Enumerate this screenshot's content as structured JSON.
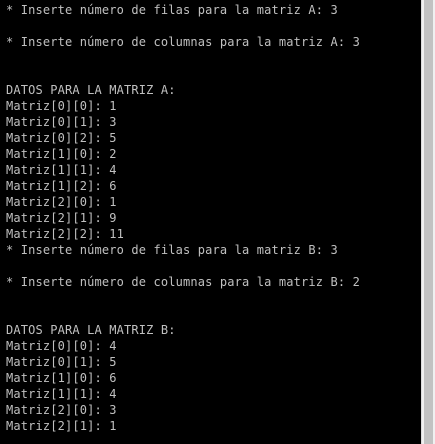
{
  "console": {
    "background": "#000000",
    "text_color": "#c0c0c0",
    "lines": [
      "* Inserte número de filas para la matriz A: 3",
      "",
      "* Inserte número de columnas para la matriz A: 3",
      "",
      "",
      "DATOS PARA LA MATRIZ A:",
      "Matriz[0][0]: 1",
      "Matriz[0][1]: 3",
      "Matriz[0][2]: 5",
      "Matriz[1][0]: 2",
      "Matriz[1][1]: 4",
      "Matriz[1][2]: 6",
      "Matriz[2][0]: 1",
      "Matriz[2][1]: 9",
      "Matriz[2][2]: 11",
      "* Inserte número de filas para la matriz B: 3",
      "",
      "* Inserte número de columnas para la matriz B: 2",
      "",
      "",
      "DATOS PARA LA MATRIZ B:",
      "Matriz[0][0]: 4",
      "Matriz[0][1]: 5",
      "Matriz[1][0]: 6",
      "Matriz[1][1]: 4",
      "Matriz[2][0]: 3",
      "Matriz[2][1]: 1"
    ]
  }
}
